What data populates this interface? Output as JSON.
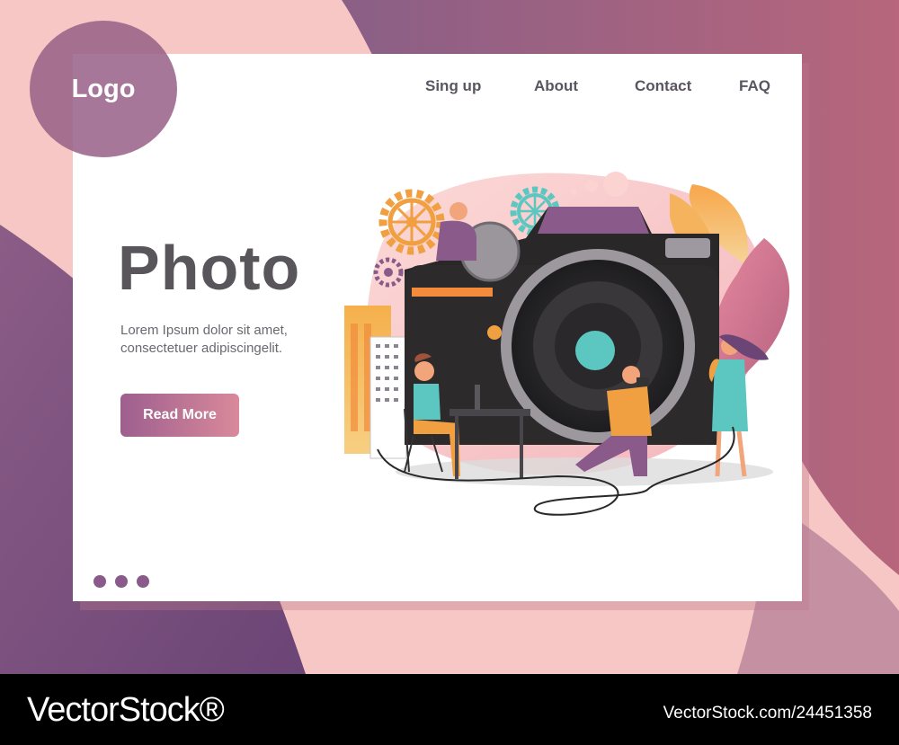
{
  "logo": {
    "label": "Logo"
  },
  "nav": {
    "items": [
      {
        "label": "Sing up"
      },
      {
        "label": "About"
      },
      {
        "label": "Contact"
      },
      {
        "label": "FAQ"
      }
    ]
  },
  "hero": {
    "title": "Photo",
    "text_line1": "Lorem Ipsum dolor sit amet,",
    "text_line2": "consectetuer adipiscingelit.",
    "button_label": "Read More"
  },
  "pagination": {
    "count": 3
  },
  "colors": {
    "accent": "#9d5f8f",
    "accent_light": "#d9899a",
    "title": "#58565b",
    "background_pink": "#f7c9c6",
    "background_purple": "#7a4f7e"
  },
  "footer": {
    "brand": "VectorStock®",
    "image_id": "VectorStock.com/24451358"
  }
}
